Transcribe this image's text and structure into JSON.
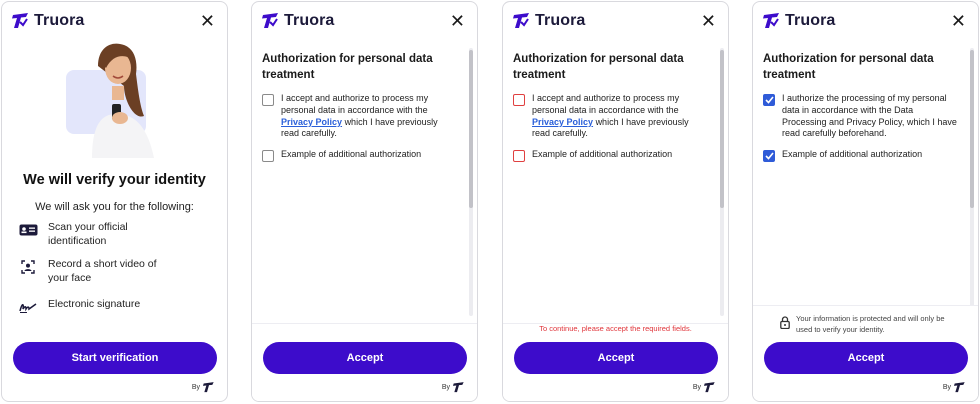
{
  "brand": {
    "name": "Truora",
    "accent": "#3d0ccb",
    "link": "#2a5fd9",
    "error": "#e0353b"
  },
  "intro": {
    "title": "We will verify your identity",
    "subtitle": "We will ask you for the following:",
    "steps": [
      {
        "icon": "id-card-icon",
        "text": "Scan your official identification"
      },
      {
        "icon": "face-scan-icon",
        "text": "Record a short video of your face"
      },
      {
        "icon": "signature-icon",
        "text": "Electronic signature"
      }
    ],
    "button": "Start verification"
  },
  "auth": {
    "title": "Authorization for personal data treatment",
    "consent_prefix": "I accept and authorize to process my personal data in accordance with the",
    "privacy_link": "Privacy Policy",
    "consent_suffix": "which I have previously read carefully.",
    "consent_alt": "I authorize the processing of my personal data in accordance with the Data Processing and Privacy Policy, which I have read carefully beforehand.",
    "additional": "Example of additional authorization",
    "button": "Accept",
    "error": "To continue, please accept the required fields.",
    "secure_note": "Your information is protected and will only be used to verify your identity."
  },
  "footer": {
    "by": "By"
  },
  "checkbox_states": {
    "screen2": [
      "unchecked",
      "unchecked"
    ],
    "screen3": [
      "error",
      "error"
    ],
    "screen4": [
      "checked",
      "checked"
    ]
  }
}
